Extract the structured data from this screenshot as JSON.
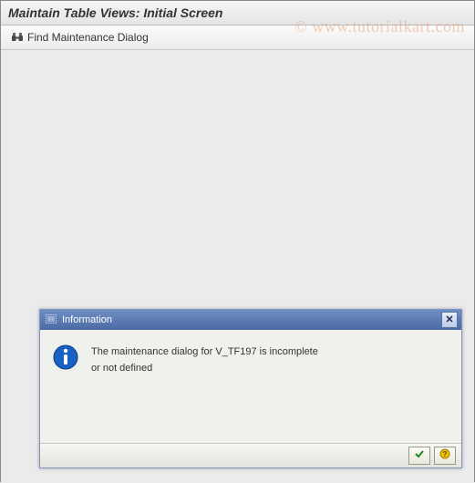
{
  "title": "Maintain Table Views: Initial Screen",
  "toolbar": {
    "find_label": "Find Maintenance Dialog"
  },
  "watermark": "© www.tutorialkart.com",
  "dialog": {
    "title": "Information",
    "message_line1": "The maintenance dialog for V_TF197 is incomplete",
    "message_line2": "or not defined"
  }
}
